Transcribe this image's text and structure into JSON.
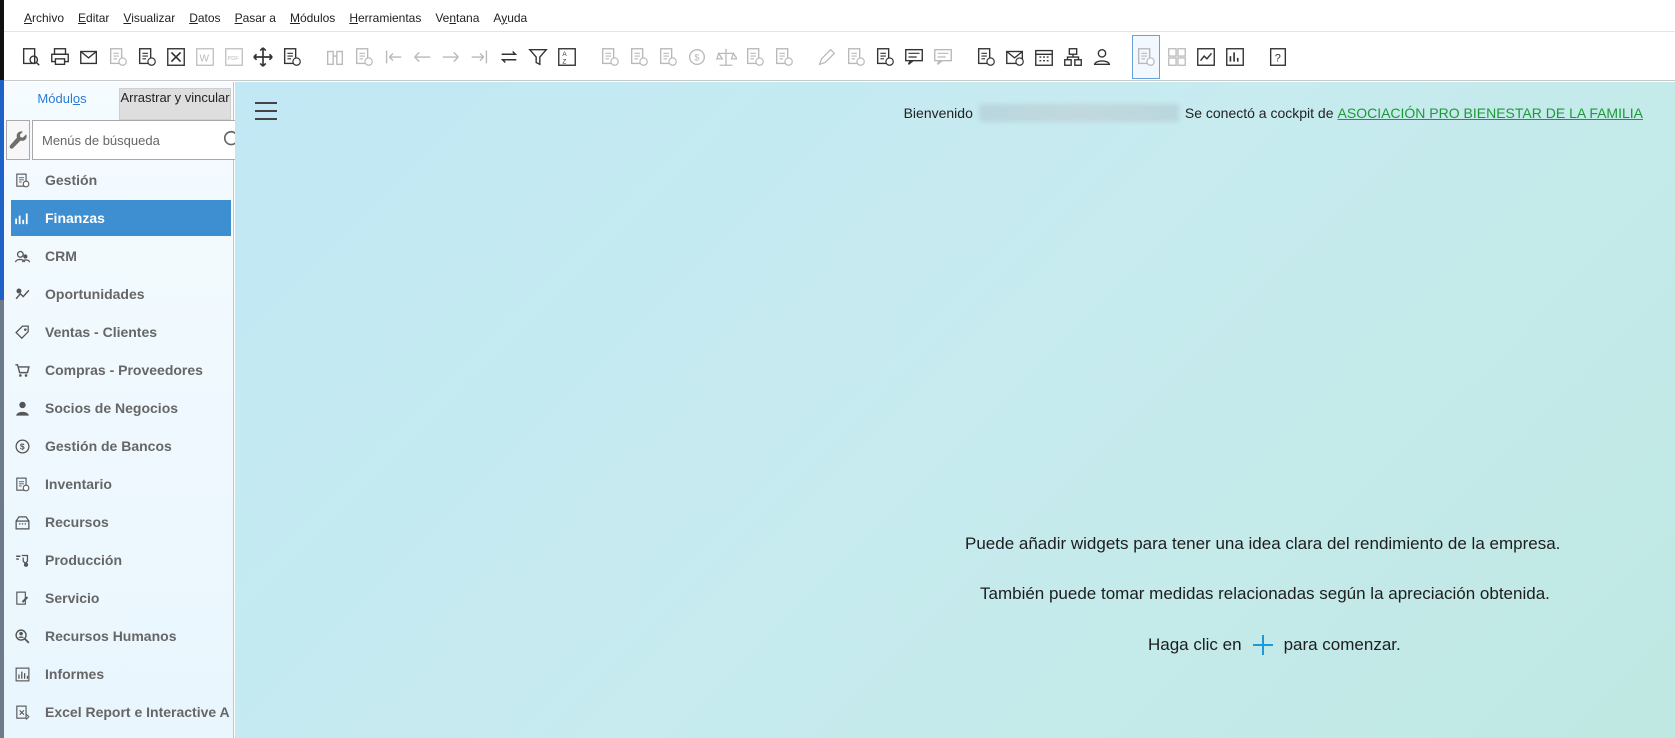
{
  "menubar": {
    "items": [
      {
        "pre": "",
        "u": "A",
        "post": "rchivo"
      },
      {
        "pre": "",
        "u": "E",
        "post": "ditar"
      },
      {
        "pre": "",
        "u": "V",
        "post": "isualizar"
      },
      {
        "pre": "",
        "u": "D",
        "post": "atos"
      },
      {
        "pre": "",
        "u": "P",
        "post": "asar a"
      },
      {
        "pre": "",
        "u": "M",
        "post": "ódulos"
      },
      {
        "pre": "",
        "u": "H",
        "post": "erramientas"
      },
      {
        "pre": "Ve",
        "u": "n",
        "post": "tana"
      },
      {
        "pre": "A",
        "u": "y",
        "post": "uda"
      }
    ]
  },
  "toolbar": {
    "icons": [
      "preview-icon",
      "print-icon",
      "email-icon",
      "fax-icon",
      "copy-window-icon",
      "excel-export-icon",
      "word-export-icon",
      "pdf-export-icon",
      "move-icon",
      "form-settings-icon",
      "gap",
      "binoculars-icon",
      "add-row-icon",
      "first-record-icon",
      "previous-record-icon",
      "next-record-icon",
      "last-record-icon",
      "refresh-icon",
      "filter-icon",
      "sort-icon",
      "gap",
      "related-doc-icon",
      "base-doc-icon",
      "target-doc-icon",
      "payment-means-icon",
      "balance-icon",
      "journal-icon",
      "drill-icon",
      "gap",
      "edit-icon",
      "settings-doc-icon",
      "layout-designer-icon",
      "messages-icon",
      "chat-icon",
      "gap",
      "calendar-alert-icon",
      "inbox-alert-icon",
      "calendar-icon",
      "org-chart-icon",
      "user-icon",
      "gap",
      "cockpit-icon",
      "widgets-icon",
      "trend-icon",
      "analytics-icon",
      "gap",
      "help-icon"
    ],
    "selected_index": 41
  },
  "sidebar": {
    "tab_modules": "Módulos",
    "tab_modules_u": "o",
    "tab_drag": "Arrastrar y vincular",
    "search_placeholder": "Menús de búsqueda",
    "items": [
      {
        "label": "Gestión",
        "icon": "administration-icon"
      },
      {
        "label": "Finanzas",
        "icon": "finance-chart-icon",
        "active": true
      },
      {
        "label": "CRM",
        "icon": "crm-people-icon"
      },
      {
        "label": "Oportunidades",
        "icon": "opportunities-icon"
      },
      {
        "label": "Ventas - Clientes",
        "icon": "sales-tag-icon"
      },
      {
        "label": "Compras - Proveedores",
        "icon": "cart-icon"
      },
      {
        "label": "Socios de Negocios",
        "icon": "person-icon"
      },
      {
        "label": "Gestión de Bancos",
        "icon": "dollar-circle-icon"
      },
      {
        "label": "Inventario",
        "icon": "inventory-icon"
      },
      {
        "label": "Recursos",
        "icon": "resources-icon"
      },
      {
        "label": "Producción",
        "icon": "production-icon"
      },
      {
        "label": "Servicio",
        "icon": "service-icon"
      },
      {
        "label": "Recursos Humanos",
        "icon": "hr-search-icon"
      },
      {
        "label": "Informes",
        "icon": "reports-icon"
      },
      {
        "label": "Excel Report e Interactive A",
        "icon": "excel-report-icon"
      }
    ]
  },
  "main": {
    "welcome_prefix": "Bienvenido",
    "welcome_mid": "Se conectó a cockpit de",
    "company": "ASOCIACIÓN PRO BIENESTAR DE LA FAMILIA",
    "hint_line1": "Puede añadir widgets para tener una idea clara del rendimiento de la empresa.",
    "hint_line2": "También puede tomar medidas relacionadas según la apreciación obtenida.",
    "hint_line3_pre": "Haga clic en",
    "hint_line3_post": "para comenzar."
  }
}
